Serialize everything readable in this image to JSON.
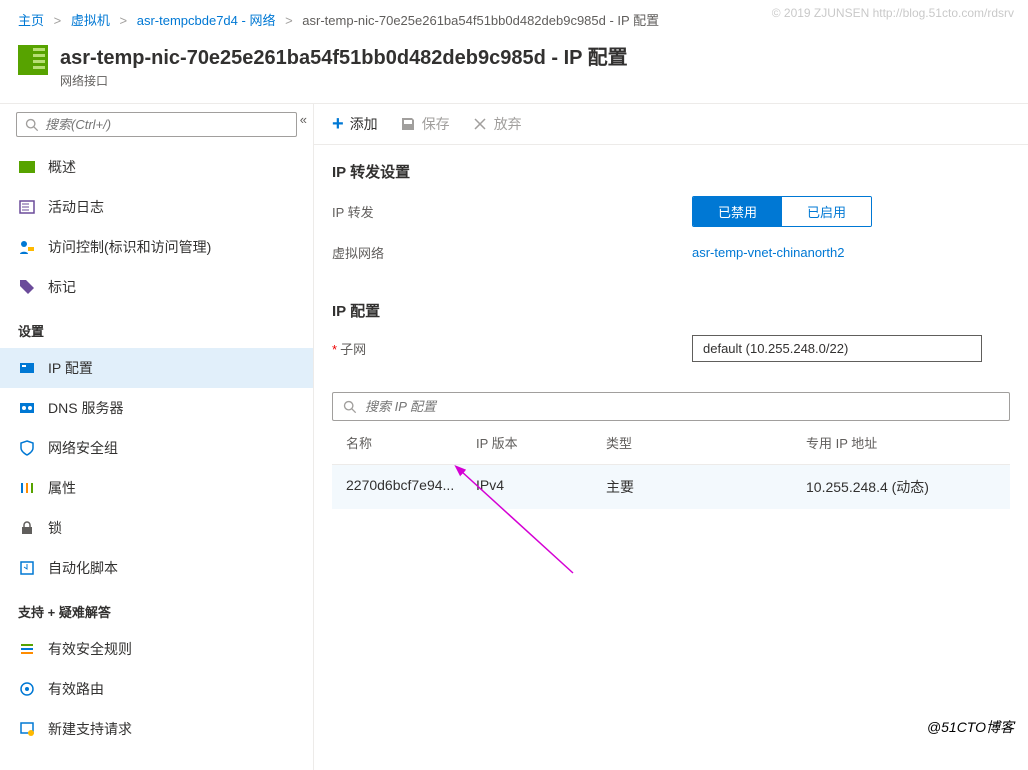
{
  "watermark": {
    "top": "© 2019 ZJUNSEN http://blog.51cto.com/rdsrv",
    "bottom": "@51CTO博客"
  },
  "breadcrumb": {
    "home": "主页",
    "vm": "虚拟机",
    "res": "asr-tempcbde7d4 - 网络",
    "leaf": "asr-temp-nic-70e25e261ba54f51bb0d482deb9c985d - IP 配置"
  },
  "header": {
    "title": "asr-temp-nic-70e25e261ba54f51bb0d482deb9c985d - IP 配置",
    "subtitle": "网络接口"
  },
  "sidebar": {
    "search_placeholder": "搜索(Ctrl+/)",
    "items": [
      {
        "label": "概述"
      },
      {
        "label": "活动日志"
      },
      {
        "label": "访问控制(标识和访问管理)"
      },
      {
        "label": "标记"
      }
    ],
    "settings_header": "设置",
    "settings": [
      {
        "label": "IP 配置",
        "active": true
      },
      {
        "label": "DNS 服务器"
      },
      {
        "label": "网络安全组"
      },
      {
        "label": "属性"
      },
      {
        "label": "锁"
      },
      {
        "label": "自动化脚本"
      }
    ],
    "support_header": "支持 + 疑难解答",
    "support": [
      {
        "label": "有效安全规则"
      },
      {
        "label": "有效路由"
      },
      {
        "label": "新建支持请求"
      }
    ]
  },
  "toolbar": {
    "add": "添加",
    "save": "保存",
    "discard": "放弃"
  },
  "content": {
    "forward_section": "IP 转发设置",
    "forward_label": "IP 转发",
    "toggle_disabled": "已禁用",
    "toggle_enabled": "已启用",
    "vnet_label": "虚拟网络",
    "vnet_value": "asr-temp-vnet-chinanorth2",
    "ipconf_section": "IP 配置",
    "subnet_label": "子网",
    "subnet_value": "default (10.255.248.0/22)",
    "ip_search_placeholder": "搜索 IP 配置",
    "cols": {
      "name": "名称",
      "ver": "IP 版本",
      "type": "类型",
      "ip": "专用 IP 地址"
    },
    "row": {
      "name": "2270d6bcf7e94...",
      "ver": "IPv4",
      "type": "主要",
      "ip": "10.255.248.4 (动态)"
    }
  }
}
